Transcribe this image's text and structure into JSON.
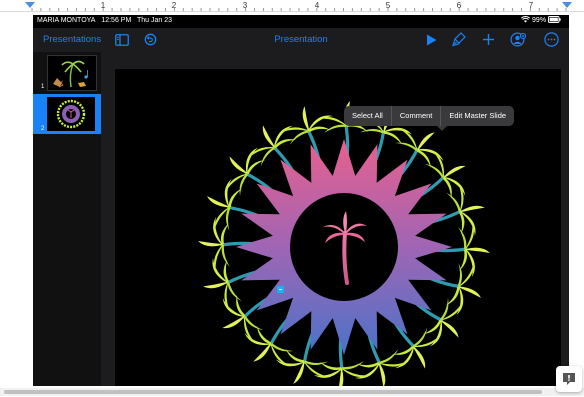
{
  "ruler": {
    "numbers": [
      "1",
      "2",
      "3",
      "4",
      "5",
      "6",
      "7"
    ]
  },
  "status_bar": {
    "name": "MARIA MONTOYA",
    "time": "12:56 PM",
    "date": "Thu Jan 23",
    "battery": "99%"
  },
  "toolbar": {
    "presentations_label": "Presentations",
    "title": "Presentation",
    "icons": [
      "sidebar-icon",
      "undo-icon",
      "play-icon",
      "brush-icon",
      "plus-icon",
      "collaborate-icon",
      "more-icon"
    ]
  },
  "sidebar": {
    "slides": [
      {
        "number": "1"
      },
      {
        "number": "2",
        "selected": true
      }
    ]
  },
  "popover": {
    "items": [
      "Select All",
      "Comment",
      "Edit Master Slide"
    ]
  },
  "colors": {
    "accent": "#1a82f7",
    "selection": "#1a82f7",
    "palm": "#c9ec3d",
    "ring_top": "#e8608e",
    "ring_bottom": "#4a73c9"
  }
}
